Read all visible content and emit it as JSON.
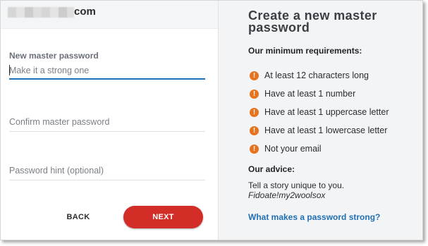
{
  "account": {
    "domain_suffix": "com"
  },
  "form": {
    "new_password": {
      "label": "New master password",
      "placeholder": "Make it a strong one",
      "value": ""
    },
    "confirm_password": {
      "placeholder": "Confirm master password",
      "value": ""
    },
    "hint": {
      "placeholder": "Password hint (optional)",
      "value": ""
    },
    "back_label": "BACK",
    "next_label": "NEXT"
  },
  "info": {
    "title": "Create a new master password",
    "requirements_heading": "Our minimum requirements:",
    "requirements": [
      {
        "icon": "warning-icon",
        "text": "At least 12 characters long"
      },
      {
        "icon": "warning-icon",
        "text": "Have at least 1 number"
      },
      {
        "icon": "warning-icon",
        "text": "Have at least 1 uppercase letter"
      },
      {
        "icon": "warning-icon",
        "text": "Have at least 1 lowercase letter"
      },
      {
        "icon": "warning-icon",
        "text": "Not your email"
      }
    ],
    "advice_heading": "Our advice:",
    "advice_text": "Tell a story unique to you.",
    "advice_example": "Fidoate!my2woolsox",
    "help_link": "What makes a password strong?"
  },
  "colors": {
    "accent_red": "#d32d27",
    "link_blue": "#1f6fb5",
    "warning_orange": "#e8731f",
    "panel_grey": "#f3f4f6"
  }
}
